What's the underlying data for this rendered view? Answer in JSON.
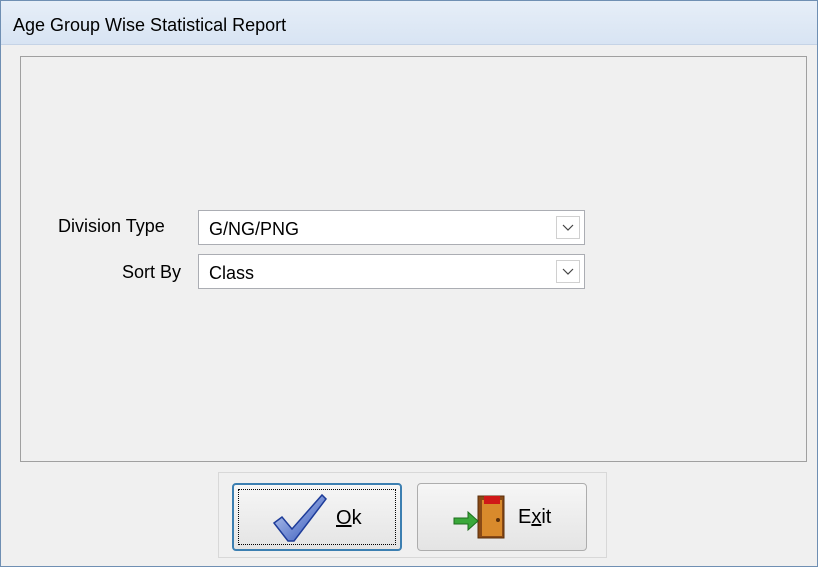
{
  "window": {
    "title": "Age Group Wise Statistical Report"
  },
  "form": {
    "division_type": {
      "label": "Division Type",
      "value": "G/NG/PNG"
    },
    "sort_by": {
      "label": "Sort By",
      "value": "Class"
    }
  },
  "buttons": {
    "ok": {
      "mnemonic": "O",
      "rest": "k",
      "icon": "checkmark-icon"
    },
    "exit": {
      "pre": "E",
      "mnemonic": "x",
      "rest": "it",
      "icon": "exit-door-icon"
    }
  },
  "colors": {
    "title_bar": "#dce7f5",
    "window_bg": "#f0f0f0",
    "focus_border": "#3c7fb1"
  }
}
